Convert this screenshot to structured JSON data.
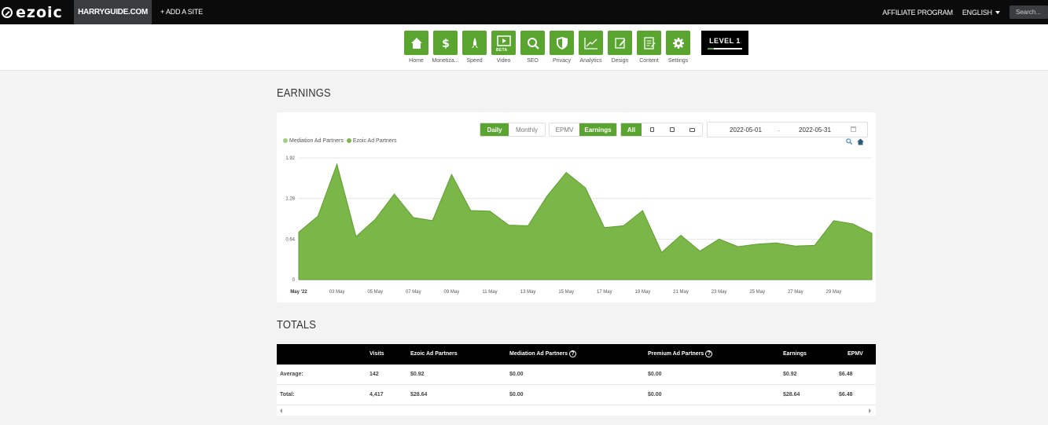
{
  "topbar": {
    "logo": "ezoic",
    "site": "HARRYGUIDE.COM",
    "add_site": "+ ADD A SITE",
    "affiliate": "AFFILIATE PROGRAM",
    "language": "ENGLISH",
    "search_placeholder": "Search..."
  },
  "nav": {
    "items": [
      {
        "label": "Home",
        "icon": "home-icon"
      },
      {
        "label": "Monetiza...",
        "icon": "dollar-icon"
      },
      {
        "label": "Speed",
        "icon": "rocket-icon"
      },
      {
        "label": "Video",
        "icon": "video-icon",
        "badge": "BETA"
      },
      {
        "label": "SEO",
        "icon": "magnifier-icon"
      },
      {
        "label": "Privacy",
        "icon": "shield-icon"
      },
      {
        "label": "Analytics",
        "icon": "analytics-icon"
      },
      {
        "label": "Design",
        "icon": "design-icon"
      },
      {
        "label": "Content",
        "icon": "content-icon"
      },
      {
        "label": "Settings",
        "icon": "gear-icon"
      }
    ],
    "level": "LEVEL 1",
    "accent": "#5aa52f"
  },
  "earnings": {
    "title": "EARNINGS",
    "period": {
      "daily": "Daily",
      "monthly": "Monthly",
      "selected": "Daily"
    },
    "metric": {
      "epmv": "EPMV",
      "earnings": "Earnings",
      "selected": "Earnings"
    },
    "device": {
      "all": "All",
      "selected": "All"
    },
    "date_start": "2022-05-01",
    "date_sep": "→",
    "date_end": "2022-05-31",
    "legend": [
      "Mediation Ad Partners",
      "Ezoic Ad Partners"
    ]
  },
  "chart_data": {
    "type": "area",
    "series": [
      {
        "name": "Mediation Ad Partners",
        "color": "#9fcf7c",
        "values": [
          0,
          0,
          0,
          0,
          0,
          0,
          0,
          0,
          0,
          0,
          0,
          0,
          0,
          0,
          0,
          0,
          0,
          0,
          0,
          0,
          0,
          0,
          0,
          0,
          0,
          0,
          0,
          0,
          0,
          0,
          0
        ]
      },
      {
        "name": "Ezoic Ad Partners",
        "color": "#7ab648",
        "values": [
          0.75,
          1.0,
          1.82,
          0.68,
          0.95,
          1.35,
          0.98,
          0.93,
          1.66,
          1.09,
          1.08,
          0.86,
          0.85,
          1.32,
          1.69,
          1.45,
          0.82,
          0.85,
          1.09,
          0.43,
          0.7,
          0.45,
          0.64,
          0.52,
          0.56,
          0.58,
          0.53,
          0.54,
          0.93,
          0.88,
          0.73
        ]
      }
    ],
    "x_ticks": [
      "May '22",
      "03 May",
      "05 May",
      "07 May",
      "09 May",
      "11 May",
      "13 May",
      "15 May",
      "17 May",
      "19 May",
      "21 May",
      "23 May",
      "25 May",
      "27 May",
      "29 May"
    ],
    "y_ticks": [
      "0",
      "0.64",
      "1.28",
      "1.92"
    ],
    "ylim": [
      0,
      1.92
    ],
    "grid": true,
    "legend_position": "top-left"
  },
  "totals": {
    "title": "TOTALS",
    "headers": {
      "visits": "Visits",
      "ezoic": "Ezoic Ad Partners",
      "mediation": "Mediation Ad Partners",
      "premium": "Premium Ad Partners",
      "earnings": "Earnings",
      "epmv": "EPMV"
    },
    "rows": [
      {
        "label": "Average:",
        "visits": "142",
        "ezoic": "$0.92",
        "mediation": "$0.00",
        "premium": "$0.00",
        "earnings": "$0.92",
        "epmv": "$6.48"
      },
      {
        "label": "Total:",
        "visits": "4,417",
        "ezoic": "$28.64",
        "mediation": "$0.00",
        "premium": "$0.00",
        "earnings": "$28.64",
        "epmv": "$6.48"
      }
    ]
  }
}
